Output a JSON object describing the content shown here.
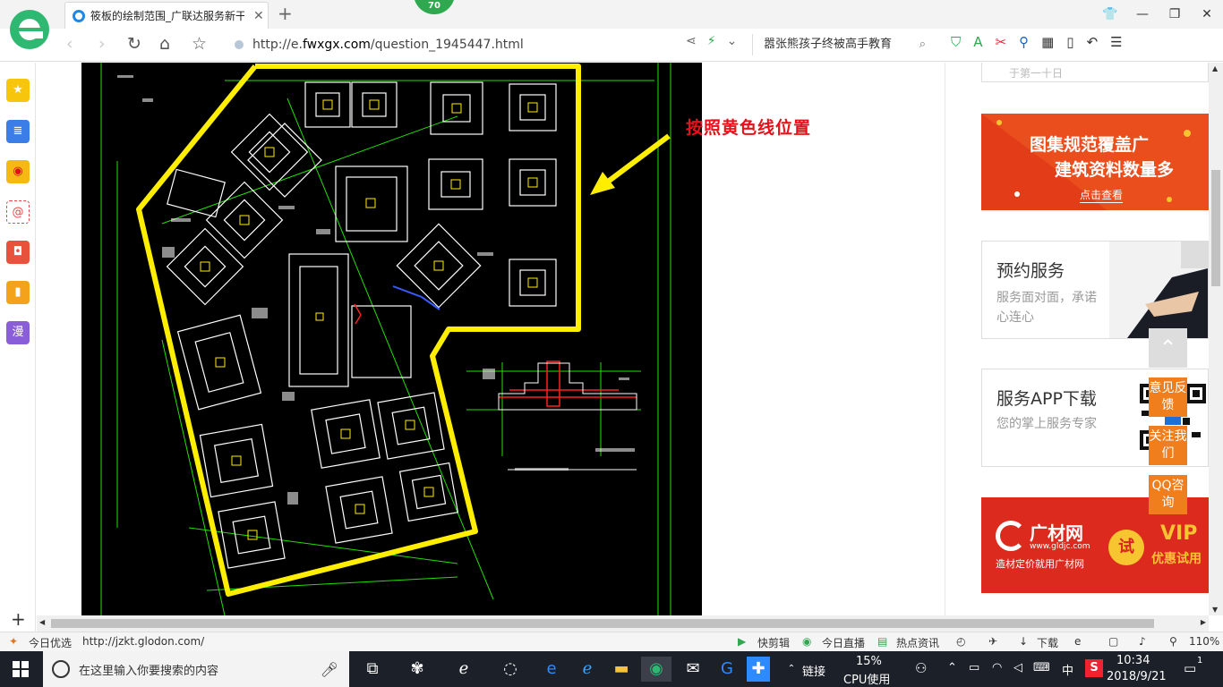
{
  "browser": {
    "tab_title": "筱板的绘制范围_广联达服务新干",
    "badge": "70",
    "url_prefix": "http://e.",
    "url_domain": "fwxgx.com",
    "url_suffix": "/question_1945447.html",
    "search_text": "嚣张熊孩子终被高手教育"
  },
  "page": {
    "annotation": "按照黄色线位置",
    "top_partial": "于第一十日",
    "banner1": {
      "line1": "图集规范覆盖广",
      "line2": "建筑资料数量多",
      "cta": "点击查看"
    },
    "card_booking": {
      "title": "预约服务",
      "desc": "服务面对面，承诺心连心"
    },
    "card_app": {
      "title": "服务APP下载",
      "desc": "您的掌上服务专家"
    },
    "banner2": {
      "brand": "广材网",
      "site": "www.gldjc.com",
      "slogan": "造材定价就用广材网",
      "try": "试",
      "vip": "VIP",
      "vip_sub": "优惠试用"
    },
    "side_buttons": [
      "意见反馈",
      "关注我们",
      "QQ咨询"
    ]
  },
  "statusbar": {
    "today": "今日优选",
    "link": "http://jzkt.glodon.com/",
    "kuaijian": "快剪辑",
    "zhibo": "今日直播",
    "news": "热点资讯",
    "download": "下载",
    "zoom": "110%"
  },
  "taskbar": {
    "search_placeholder": "在这里输入你要搜索的内容",
    "lianjie": "链接",
    "cpu_percent": "15%",
    "cpu_label": "CPU使用",
    "ime": "中",
    "time": "10:34",
    "date": "2018/9/21",
    "notif": "1"
  },
  "colors": {
    "accent": "#f07e1c",
    "cad_line": "#22e000",
    "highlight": "#ffee00",
    "annotation": "#e8101a"
  }
}
